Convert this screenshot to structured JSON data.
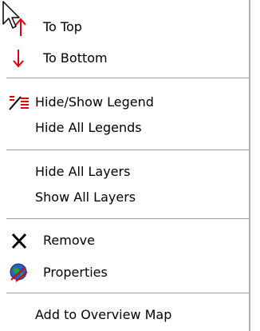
{
  "menu": {
    "items": [
      {
        "label": "To Top",
        "icon": "up-arrow-icon"
      },
      {
        "label": "To Bottom",
        "icon": "down-arrow-icon"
      },
      {
        "label": "Hide/Show Legend",
        "icon": "legend-icon"
      },
      {
        "label": "Hide All Legends",
        "icon": ""
      },
      {
        "label": "Hide All Layers",
        "icon": ""
      },
      {
        "label": "Show All Layers",
        "icon": ""
      },
      {
        "label": "Remove",
        "icon": "remove-x-icon"
      },
      {
        "label": "Properties",
        "icon": "properties-globe-icon"
      },
      {
        "label": "Add to Overview Map",
        "icon": ""
      }
    ]
  },
  "colors": {
    "arrow": "#e00000",
    "separator": "#a0a0a0",
    "legend_red": "#e00000"
  }
}
